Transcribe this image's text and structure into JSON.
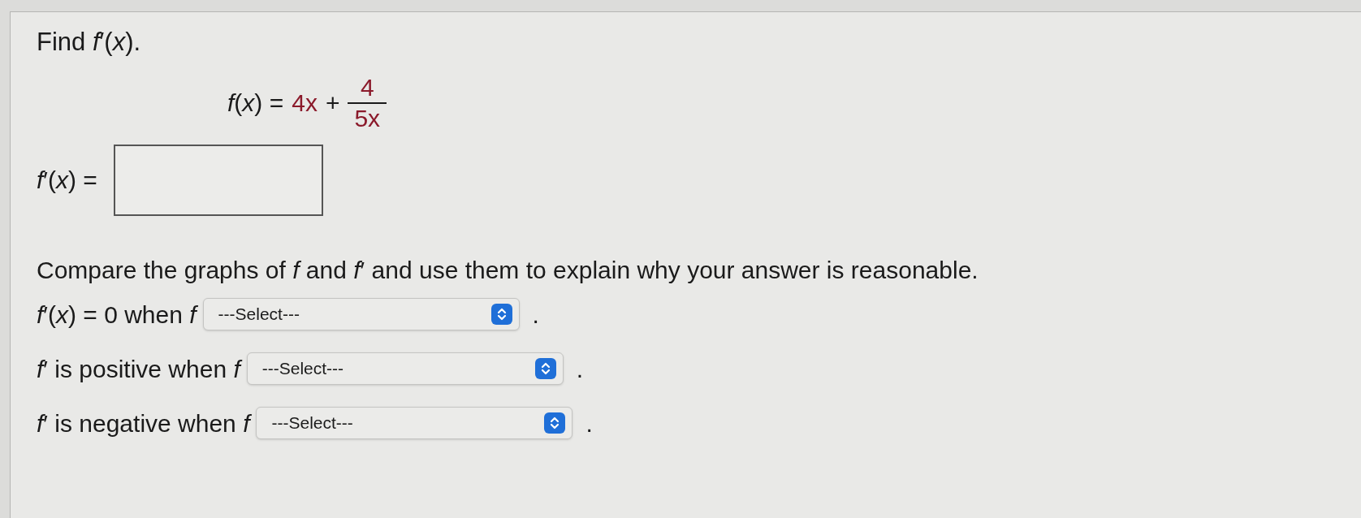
{
  "question": {
    "prompt": "Find *f*′(*x*).",
    "function": {
      "lhs": "*f*(*x*) =",
      "term": "4x",
      "operator": "+",
      "numerator": "4",
      "denominator": "5x"
    },
    "answer": {
      "label": "*f*′(*x*) ="
    }
  },
  "comparison": {
    "instruction": "Compare the graphs of *f* and *f*′ and use them to explain why your answer is reasonable.",
    "statements": [
      {
        "label": "*f*′(*x*) = 0 when *f*",
        "dropdown": "---Select---",
        "end": "."
      },
      {
        "label": "*f*′ is positive when *f*",
        "dropdown": "---Select---",
        "end": "."
      },
      {
        "label": "*f*′ is negative when *f*",
        "dropdown": "---Select---",
        "end": "."
      }
    ]
  }
}
